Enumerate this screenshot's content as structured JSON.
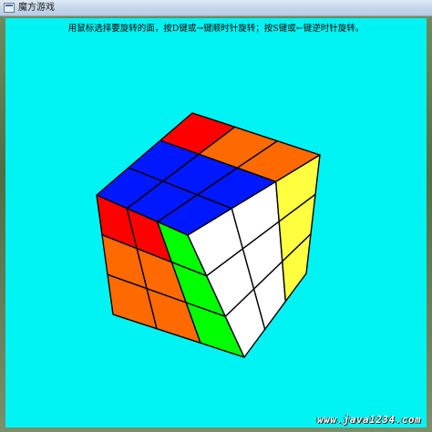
{
  "window": {
    "title": "魔方游戏"
  },
  "instructions": "用鼠标选择要旋转的面，按D键或→键顺时针旋转；按S键或←键逆时针旋转。",
  "watermark": "www.java1234.com",
  "colors": {
    "background": "#00f3f3",
    "blue": "#0018ff",
    "red": "#ff0000",
    "orange": "#ff6a00",
    "green": "#00ff00",
    "white": "#ffffff",
    "yellow": "#ffff40"
  },
  "cube": {
    "top_face": [
      [
        "blue",
        "blue",
        "red"
      ],
      [
        "blue",
        "blue",
        "orange"
      ],
      [
        "blue",
        "blue",
        "orange"
      ]
    ],
    "left_face": [
      [
        "red",
        "red",
        "green"
      ],
      [
        "orange",
        "orange",
        "green"
      ],
      [
        "orange",
        "orange",
        "green"
      ]
    ],
    "right_face": [
      [
        "white",
        "white",
        "yellow"
      ],
      [
        "white",
        "white",
        "yellow"
      ],
      [
        "white",
        "white",
        "yellow"
      ]
    ]
  }
}
